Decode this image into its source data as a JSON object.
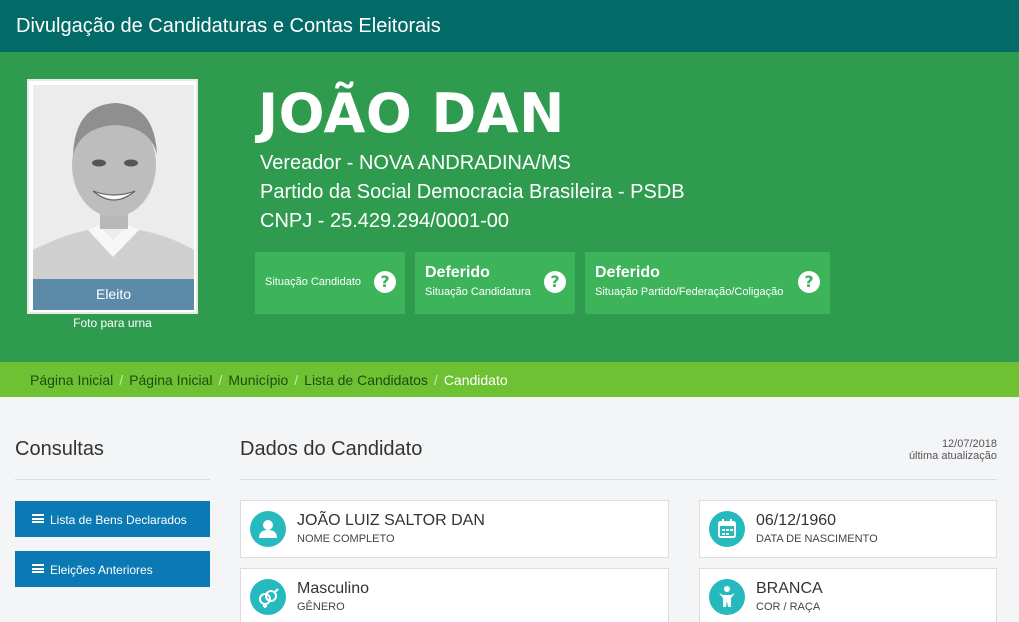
{
  "app": {
    "title": "Divulgação de Candidaturas e Contas Eleitorais"
  },
  "hero": {
    "photo_status": "Eleito",
    "photo_caption": "Foto para urna",
    "name": "JOÃO DAN",
    "office": "Vereador - NOVA ANDRADINA/MS",
    "party": "Partido da Social Democracia Brasileira - PSDB",
    "cnpj": "CNPJ - 25.429.294/0001-00",
    "status_boxes": [
      {
        "value": "",
        "label": "Situação Candidato"
      },
      {
        "value": "Deferido",
        "label": "Situação Candidatura"
      },
      {
        "value": "Deferido",
        "label": "Situação Partido/Federação/Coligação"
      }
    ],
    "help_glyph": "?"
  },
  "breadcrumb": {
    "items": [
      "Página Inicial",
      "Página Inicial",
      "Município",
      "Lista de Candidatos",
      "Candidato"
    ],
    "separator": "/"
  },
  "sidebar": {
    "title": "Consultas",
    "buttons": [
      {
        "label": "Lista de Bens Declarados",
        "icon": "list-icon"
      },
      {
        "label": "Eleições Anteriores",
        "icon": "list-icon"
      }
    ]
  },
  "main": {
    "title": "Dados do Candidato",
    "updated_date": "12/07/2018",
    "updated_label": "última atualização",
    "cards": [
      {
        "value": "JOÃO LUIZ SALTOR DAN",
        "label": "NOME COMPLETO",
        "icon": "user-icon"
      },
      {
        "value": "06/12/1960",
        "label": "DATA DE NASCIMENTO",
        "icon": "calendar-icon"
      },
      {
        "value": "Masculino",
        "label": "GÊNERO",
        "icon": "gender-icon"
      },
      {
        "value": "BRANCA",
        "label": "COR / RAÇA",
        "icon": "person-icon"
      }
    ]
  },
  "colors": {
    "topbar": "#036b67",
    "hero": "#2f9b4f",
    "status_box": "#3db45a",
    "breadcrumb": "#6dc133",
    "sidebar_button": "#0b79b4",
    "card_icon": "#26b9be",
    "photo_badge": "#5b8ba8"
  }
}
